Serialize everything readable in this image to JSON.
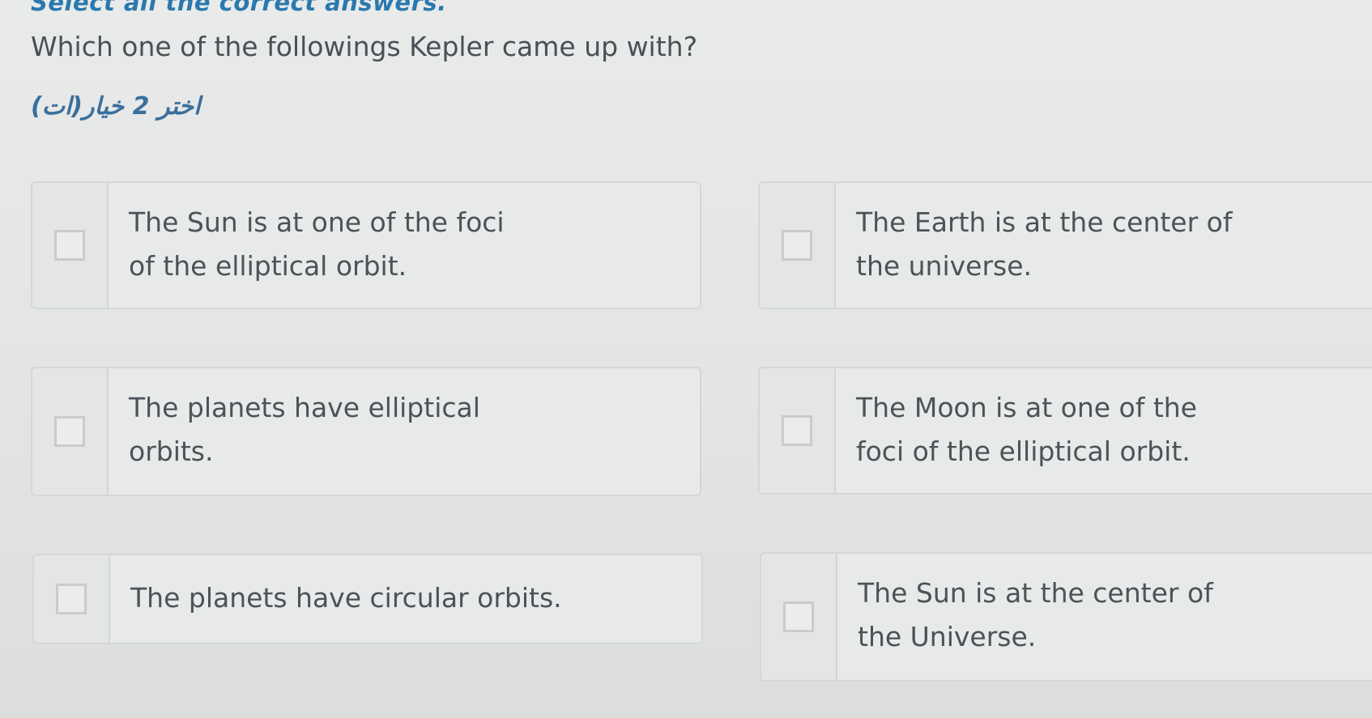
{
  "instruction": "Select all the correct answers.",
  "question": "Which one of the followings Kepler came up with?",
  "hint": "اختر 2 خيار(ات)",
  "options": [
    {
      "text": "The Sun is at one of the foci of the elliptical orbit."
    },
    {
      "text": "The Earth is at the center of the universe."
    },
    {
      "text": "The planets have elliptical orbits."
    },
    {
      "text": "The Moon is at one of the foci of the elliptical orbit."
    },
    {
      "text": "The planets have circular orbits."
    },
    {
      "text": "The Sun is at the center of the Universe."
    }
  ]
}
